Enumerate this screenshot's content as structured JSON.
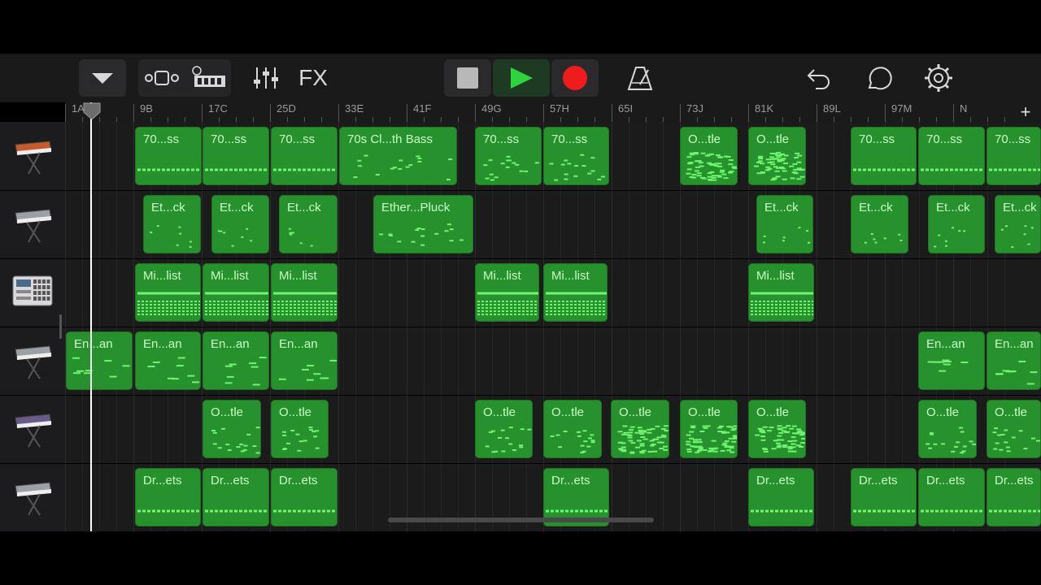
{
  "toolbar": {
    "fx_label": "FX",
    "add_track_label": "+"
  },
  "ruler": {
    "markers": [
      "1A",
      "9B",
      "17C",
      "25D",
      "33E",
      "41F",
      "49G",
      "57H",
      "65I",
      "73J",
      "81K",
      "89L",
      "97M",
      "N"
    ]
  },
  "tracks": [
    {
      "instrument": "synth-keyboard-icon",
      "regions": [
        {
          "label": "70...ss",
          "pattern": "line"
        },
        {
          "label": "70...ss",
          "pattern": "line"
        },
        {
          "label": "70...ss",
          "pattern": "line"
        },
        {
          "label": "70s Cl...th Bass",
          "pattern": "scatter"
        },
        {
          "label": "70...ss",
          "pattern": "scatter"
        },
        {
          "label": "70...ss",
          "pattern": "scatter"
        },
        {
          "label": "O...tle",
          "pattern": "dense"
        },
        {
          "label": "O...tle",
          "pattern": "dense"
        },
        {
          "label": "70...ss",
          "pattern": "line"
        },
        {
          "label": "70...ss",
          "pattern": "line"
        },
        {
          "label": "70...ss",
          "pattern": "line"
        }
      ]
    },
    {
      "instrument": "keyboard-stand-icon",
      "regions": [
        {
          "label": "Et...ck",
          "pattern": "sparse"
        },
        {
          "label": "Et...ck",
          "pattern": "sparse"
        },
        {
          "label": "Et...ck",
          "pattern": "sparse"
        },
        {
          "label": "Ether...Pluck",
          "pattern": "scatter"
        },
        {
          "label": "Et...ck",
          "pattern": "sparse"
        },
        {
          "label": "Et...ck",
          "pattern": "sparse"
        },
        {
          "label": "Et...ck",
          "pattern": "sparse"
        },
        {
          "label": "Et...ck",
          "pattern": "sparse"
        }
      ]
    },
    {
      "instrument": "drum-machine-icon",
      "regions": [
        {
          "label": "Mi...list",
          "pattern": "drum"
        },
        {
          "label": "Mi...list",
          "pattern": "drum"
        },
        {
          "label": "Mi...list",
          "pattern": "drum"
        },
        {
          "label": "Mi...list",
          "pattern": "drum"
        },
        {
          "label": "Mi...list",
          "pattern": "drum"
        },
        {
          "label": "Mi...list",
          "pattern": "drum"
        }
      ]
    },
    {
      "instrument": "keyboard-stand-icon",
      "regions": [
        {
          "label": "En...an",
          "pattern": "dash"
        },
        {
          "label": "En...an",
          "pattern": "dash"
        },
        {
          "label": "En...an",
          "pattern": "dash"
        },
        {
          "label": "En...an",
          "pattern": "dash"
        },
        {
          "label": "En...an",
          "pattern": "dash"
        },
        {
          "label": "En...an",
          "pattern": "dash"
        }
      ]
    },
    {
      "instrument": "synth-stand-icon",
      "regions": [
        {
          "label": "O...tle",
          "pattern": "scatter"
        },
        {
          "label": "O...tle",
          "pattern": "scatter"
        },
        {
          "label": "O...tle",
          "pattern": "scatter"
        },
        {
          "label": "O...tle",
          "pattern": "scatter"
        },
        {
          "label": "O...tle",
          "pattern": "dense"
        },
        {
          "label": "O...tle",
          "pattern": "dense"
        },
        {
          "label": "O...tle",
          "pattern": "dense"
        },
        {
          "label": "O...tle",
          "pattern": "scatter"
        },
        {
          "label": "O...tle",
          "pattern": "scatter"
        }
      ]
    },
    {
      "instrument": "keyboard-stand-icon",
      "regions": [
        {
          "label": "Dr...ets",
          "pattern": "line"
        },
        {
          "label": "Dr...ets",
          "pattern": "line"
        },
        {
          "label": "Dr...ets",
          "pattern": "line"
        },
        {
          "label": "Dr...ets",
          "pattern": "line"
        },
        {
          "label": "Dr...ets",
          "pattern": "line"
        },
        {
          "label": "Dr...ets",
          "pattern": "line"
        },
        {
          "label": "Dr...ets",
          "pattern": "line"
        },
        {
          "label": "Dr...ets",
          "pattern": "line"
        }
      ]
    }
  ]
}
